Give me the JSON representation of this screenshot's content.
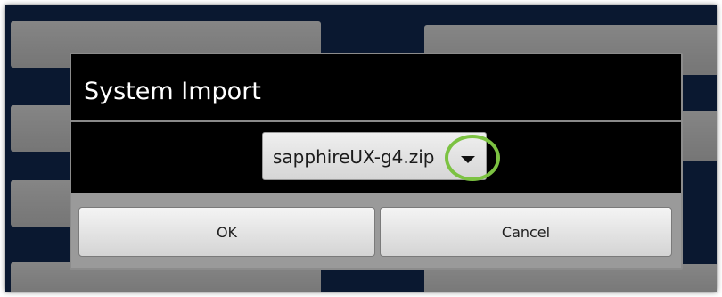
{
  "dialog": {
    "title": "System Import",
    "spinner": {
      "selected_value": "sapphireUX-g4.zip",
      "highlight_color": "#7cc242"
    },
    "buttons": {
      "ok_label": "OK",
      "cancel_label": "Cancel"
    },
    "icons": {
      "dropdown": "chevron-down-icon"
    }
  }
}
